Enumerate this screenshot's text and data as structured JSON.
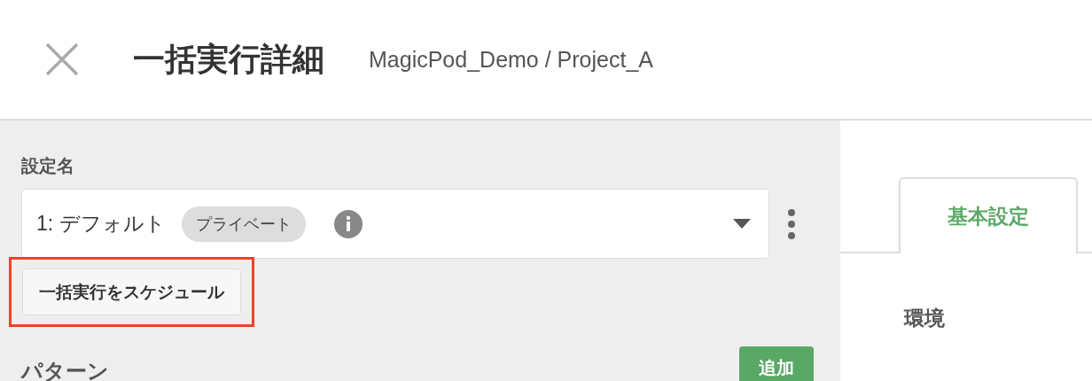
{
  "header": {
    "title": "一括実行詳細",
    "breadcrumb": "MagicPod_Demo / Project_A"
  },
  "settings": {
    "label": "設定名",
    "value": "1: デフォルト",
    "badge": "プライベート",
    "schedule_button": {
      "label": "一括実行をスケジュール",
      "highlighted": true
    }
  },
  "pattern": {
    "label": "パターン",
    "add_button": "追加"
  },
  "tabs": [
    {
      "label": "基本設定",
      "selected": true
    }
  ],
  "environment": {
    "label": "環境"
  }
}
